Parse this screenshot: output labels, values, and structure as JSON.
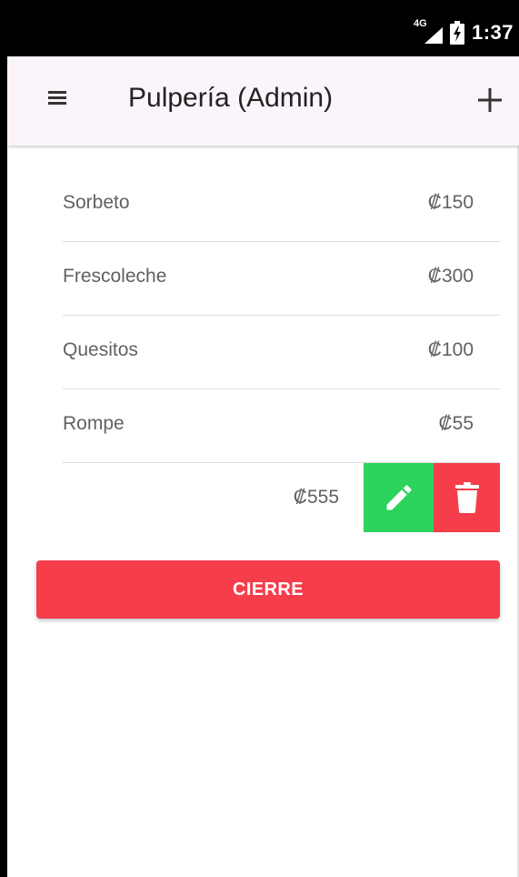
{
  "status_bar": {
    "network": "4G",
    "time": "1:37"
  },
  "app_bar": {
    "title": "Pulpería (Admin)",
    "menu_icon": "menu-icon",
    "add_icon": "plus-icon"
  },
  "products": [
    {
      "name": "Sorbeto",
      "price": "₡150"
    },
    {
      "name": "Frescoleche",
      "price": "₡300"
    },
    {
      "name": "Quesitos",
      "price": "₡100"
    },
    {
      "name": "Rompe",
      "price": "₡55"
    }
  ],
  "swiped_item": {
    "price": "₡555",
    "edit_icon": "pencil-icon",
    "delete_icon": "trash-icon"
  },
  "actions": {
    "cierre_label": "CIERRE"
  },
  "colors": {
    "edit": "#2dd35c",
    "delete": "#f53d4c",
    "cierre": "#f53d4c",
    "app_bar": "#fbf4fb",
    "status_bar": "#000000"
  }
}
